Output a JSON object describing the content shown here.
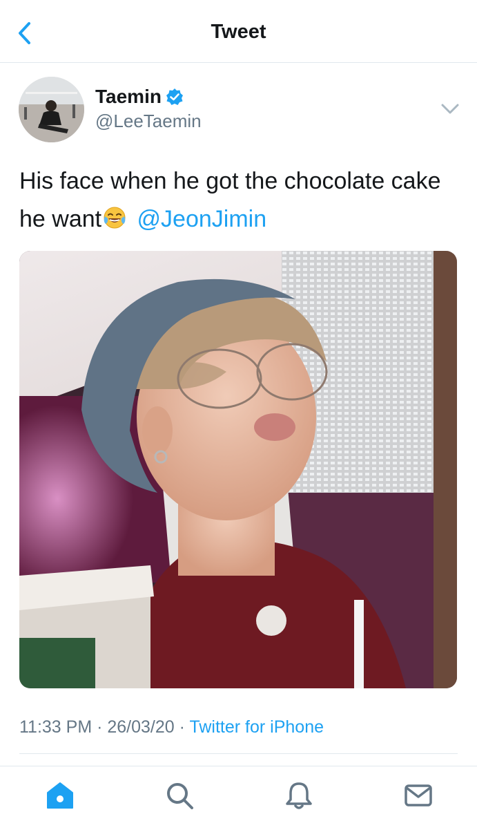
{
  "header": {
    "title": "Tweet"
  },
  "tweet": {
    "display_name": "Taemin",
    "handle": "@LeeTaemin",
    "text": "His face when he got the chocolate cake he want",
    "mention": "@JeonJimin",
    "time": "11:33 PM",
    "date": "26/03/20",
    "source": "Twitter for iPhone"
  },
  "colors": {
    "accent": "#1da1f2",
    "secondary_text": "#657786",
    "primary_text": "#14171a",
    "divider": "#e1e8ed"
  },
  "icons": {
    "header": [
      "chevron-left-icon"
    ],
    "tweet": [
      "verified-badge-icon",
      "chevron-down-icon",
      "face-with-tears-of-joy-emoji"
    ],
    "tabbar": [
      "home-icon",
      "search-icon",
      "notifications-bell-icon",
      "messages-envelope-icon"
    ]
  },
  "tabbar": {
    "active": "home"
  }
}
